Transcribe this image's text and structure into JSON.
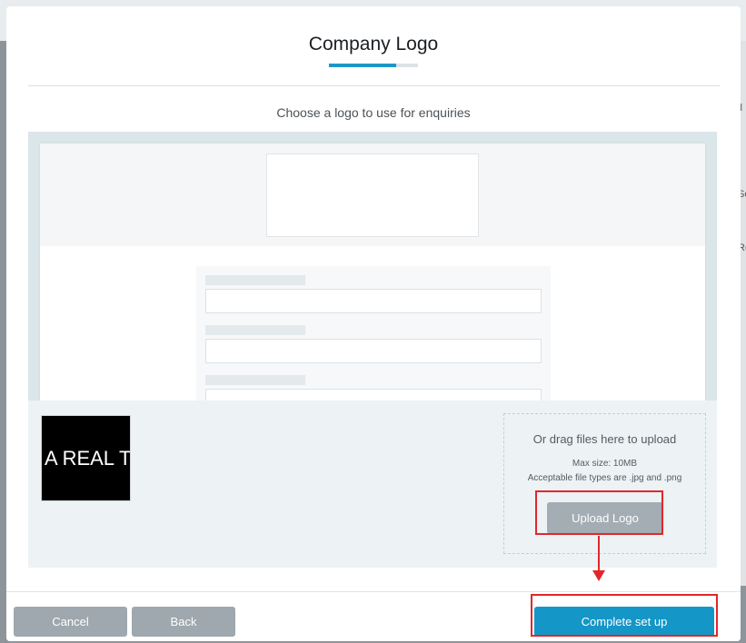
{
  "modal": {
    "title": "Company Logo",
    "progress_fraction": 0.75,
    "subtitle": "Choose a logo to use for enquiries"
  },
  "logo_preview": {
    "text": "A REAL T"
  },
  "upload": {
    "drag_text": "Or drag files here to upload",
    "max_size": "Max size: 10MB",
    "file_types": "Acceptable file types are .jpg and .png",
    "button_label": "Upload Logo"
  },
  "footer": {
    "cancel_label": "Cancel",
    "back_label": "Back",
    "complete_label": "Complete set up"
  },
  "background_fragments": [
    "ll",
    "Se",
    "Re"
  ],
  "colors": {
    "accent": "#1496c7",
    "annotation": "#e3262b",
    "secondary_button": "#9ea8ae"
  }
}
